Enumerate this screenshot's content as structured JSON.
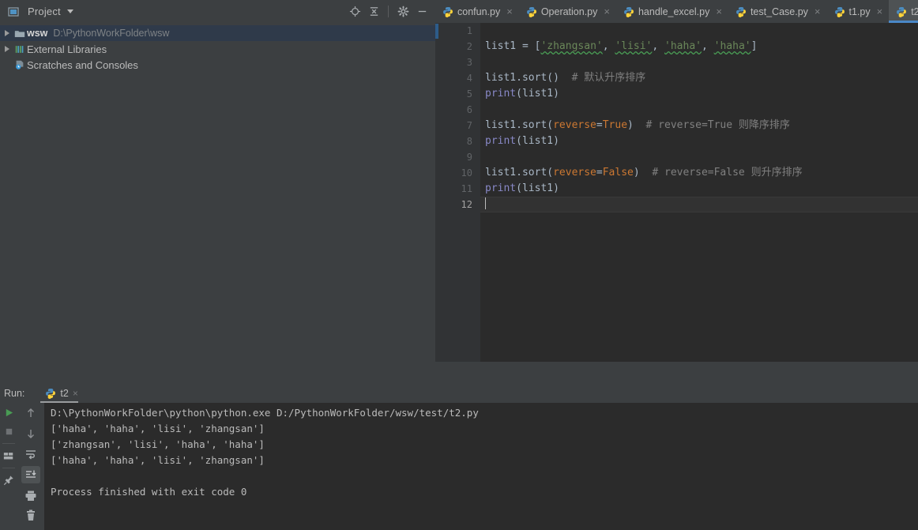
{
  "project_panel": {
    "title": "Project",
    "caret_icon": "chevron-down-icon",
    "toolbar": [
      {
        "name": "locate-target-icon",
        "label": "Select Opened File"
      },
      {
        "name": "collapse-all-icon",
        "label": "Collapse All"
      },
      {
        "name": "gear-icon",
        "label": "Settings"
      },
      {
        "name": "minimize-icon",
        "label": "Hide"
      }
    ],
    "tree": [
      {
        "name": "wsw",
        "path": "D:\\PythonWorkFolder\\wsw",
        "icon": "folder-icon",
        "arrow": "triangle-right-icon",
        "selected": true
      },
      {
        "name": "External Libraries",
        "path": "",
        "icon": "library-bars-icon",
        "arrow": "triangle-right-icon",
        "selected": false
      },
      {
        "name": "Scratches and Consoles",
        "path": "",
        "icon": "scratches-clock-icon",
        "arrow": "",
        "selected": false
      }
    ]
  },
  "editor_tabs": [
    {
      "label": "confun.py",
      "icon": "python-file-icon",
      "active": false,
      "close": "×"
    },
    {
      "label": "Operation.py",
      "icon": "python-file-icon",
      "active": false,
      "close": "×"
    },
    {
      "label": "handle_excel.py",
      "icon": "python-file-icon",
      "active": false,
      "close": "×"
    },
    {
      "label": "test_Case.py",
      "icon": "python-file-icon",
      "active": false,
      "close": "×"
    },
    {
      "label": "t1.py",
      "icon": "python-file-icon",
      "active": false,
      "close": "×"
    },
    {
      "label": "t2",
      "icon": "python-file-icon",
      "active": true,
      "close": ""
    }
  ],
  "editor": {
    "line_numbers": [
      "1",
      "2",
      "3",
      "4",
      "5",
      "6",
      "7",
      "8",
      "9",
      "10",
      "11",
      "12"
    ],
    "current_line": 12,
    "lines": [
      {
        "n": 1,
        "segments": []
      },
      {
        "n": 2,
        "segments": [
          {
            "t": "list1 = [",
            "c": "plain"
          },
          {
            "t": "'zhangsan'",
            "c": "string"
          },
          {
            "t": ", ",
            "c": "plain"
          },
          {
            "t": "'lisi'",
            "c": "string"
          },
          {
            "t": ", ",
            "c": "plain"
          },
          {
            "t": "'haha'",
            "c": "string"
          },
          {
            "t": ", ",
            "c": "plain"
          },
          {
            "t": "'haha'",
            "c": "string"
          },
          {
            "t": "]",
            "c": "plain"
          }
        ]
      },
      {
        "n": 3,
        "segments": []
      },
      {
        "n": 4,
        "segments": [
          {
            "t": "list1.sort()",
            "c": "plain"
          },
          {
            "t": "  # 默认升序排序",
            "c": "comment"
          }
        ]
      },
      {
        "n": 5,
        "segments": [
          {
            "t": "print",
            "c": "pyfunc"
          },
          {
            "t": "(list1)",
            "c": "plain"
          }
        ]
      },
      {
        "n": 6,
        "segments": []
      },
      {
        "n": 7,
        "segments": [
          {
            "t": "list1.sort(",
            "c": "plain"
          },
          {
            "t": "reverse",
            "c": "kwarg"
          },
          {
            "t": "=",
            "c": "plain"
          },
          {
            "t": "True",
            "c": "kwarg"
          },
          {
            "t": ")",
            "c": "plain"
          },
          {
            "t": "  # reverse=True 则降序排序",
            "c": "comment"
          }
        ]
      },
      {
        "n": 8,
        "segments": [
          {
            "t": "print",
            "c": "pyfunc"
          },
          {
            "t": "(list1)",
            "c": "plain"
          }
        ]
      },
      {
        "n": 9,
        "segments": []
      },
      {
        "n": 10,
        "segments": [
          {
            "t": "list1.sort(",
            "c": "plain"
          },
          {
            "t": "reverse",
            "c": "kwarg"
          },
          {
            "t": "=",
            "c": "plain"
          },
          {
            "t": "False",
            "c": "kwarg"
          },
          {
            "t": ")",
            "c": "plain"
          },
          {
            "t": "  # reverse=False 则升序排序",
            "c": "comment"
          }
        ]
      },
      {
        "n": 11,
        "segments": [
          {
            "t": "print",
            "c": "pyfunc"
          },
          {
            "t": "(list1)",
            "c": "plain"
          }
        ]
      },
      {
        "n": 12,
        "segments": []
      }
    ]
  },
  "run_panel": {
    "label": "Run:",
    "tab": {
      "label": "t2",
      "icon": "python-file-icon",
      "close": "×"
    },
    "left_toolbar": [
      {
        "name": "rerun-icon",
        "label": "Rerun"
      },
      {
        "name": "stop-icon",
        "label": "Stop"
      },
      {
        "name": "layout-icon",
        "label": "Layout"
      },
      {
        "name": "pin-icon",
        "label": "Pin Tab"
      }
    ],
    "console_toolbar": [
      {
        "name": "arrow-up-icon",
        "label": "Up the Stack Trace"
      },
      {
        "name": "arrow-down-icon",
        "label": "Down the Stack Trace"
      },
      {
        "name": "soft-wrap-icon",
        "label": "Soft-Wrap"
      },
      {
        "name": "scroll-to-end-icon",
        "label": "Scroll to End",
        "selected": true
      },
      {
        "name": "print-icon",
        "label": "Print"
      },
      {
        "name": "trash-icon",
        "label": "Clear All"
      }
    ],
    "output": [
      "D:\\PythonWorkFolder\\python\\python.exe D:/PythonWorkFolder/wsw/test/t2.py",
      "['haha', 'haha', 'lisi', 'zhangsan']",
      "['zhangsan', 'lisi', 'haha', 'haha']",
      "['haha', 'haha', 'lisi', 'zhangsan']",
      "",
      "Process finished with exit code 0"
    ]
  },
  "colors": {
    "chrome": "#3c3f41",
    "editor_bg": "#2b2b2b",
    "gutter_bg": "#313335",
    "accent_blue": "#4a88c7",
    "selection": "#2f3a4a",
    "string": "#6a8759",
    "keyword_arg": "#cc7832",
    "comment": "#808080",
    "text": "#bbbbbb"
  }
}
